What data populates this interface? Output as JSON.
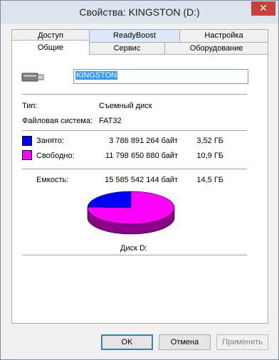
{
  "window": {
    "title": "Свойства: KINGSTON (D:)",
    "close_glyph": "✕"
  },
  "tabs_row1": [
    "Доступ",
    "ReadyBoost",
    "Настройка"
  ],
  "tabs_row2": [
    "Общие",
    "Сервис",
    "Оборудование"
  ],
  "general": {
    "name_value": "KINGSTON",
    "type_label": "Тип:",
    "type_value": "Съемный диск",
    "fs_label": "Файловая система:",
    "fs_value": "FAT32",
    "used_label": "Занято:",
    "used_bytes": "3 786 891 264 байт",
    "used_size": "3,52 ГБ",
    "free_label": "Свободно:",
    "free_bytes": "11 798 650 880 байт",
    "free_size": "10,9 ГБ",
    "cap_label": "Емкость:",
    "cap_bytes": "15 585 542 144 байт",
    "cap_size": "14,5 ГБ",
    "disk_label": "Диск D:"
  },
  "colors": {
    "used": "#0000ff",
    "free": "#ff00ff"
  },
  "usage": {
    "used_fraction": 0.243
  },
  "buttons": {
    "ok": "OK",
    "cancel": "Отмена",
    "apply": "Применить"
  }
}
